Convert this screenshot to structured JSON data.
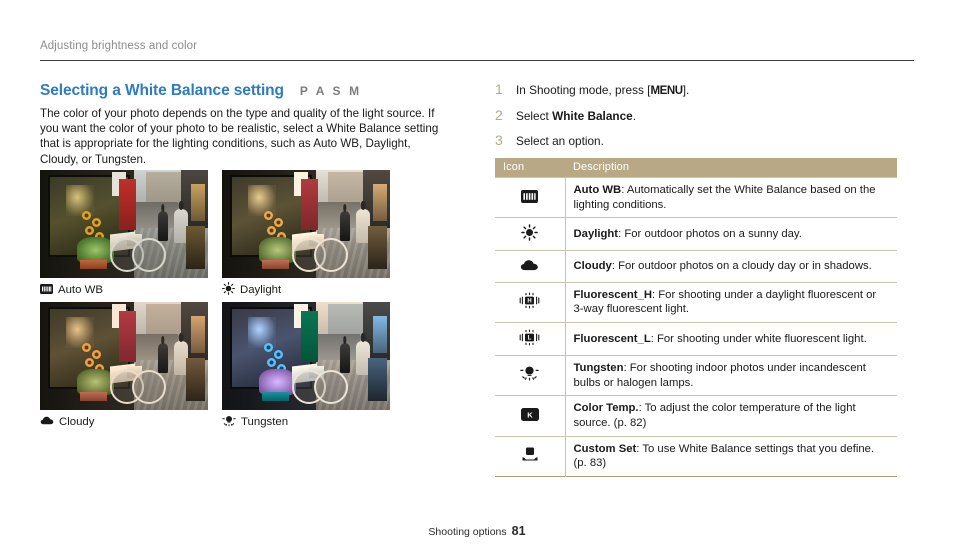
{
  "running_head": "Adjusting brightness and color",
  "section": {
    "title": "Selecting a White Balance setting",
    "modes": "P A S M",
    "body": "The color of your photo depends on the type and quality of the light source. If you want the color of your photo to be realistic, select a White Balance setting that is appropriate for the lighting conditions, such as Auto WB, Daylight, Cloudy, or Tungsten."
  },
  "samples": [
    {
      "caption": "Auto WB",
      "icon": "auto-wb-icon"
    },
    {
      "caption": "Daylight",
      "icon": "daylight-sun-icon"
    },
    {
      "caption": "Cloudy",
      "icon": "cloud-icon"
    },
    {
      "caption": "Tungsten",
      "icon": "tungsten-bulb-icon"
    }
  ],
  "steps": [
    {
      "num": "1",
      "text_before": "In Shooting mode, press [",
      "key": "MENU",
      "text_after": "]."
    },
    {
      "num": "2",
      "text_before": "Select ",
      "bold": "White Balance",
      "text_after": "."
    },
    {
      "num": "3",
      "text_before": "Select an option.",
      "bold": "",
      "text_after": ""
    }
  ],
  "table": {
    "headers": {
      "icon": "Icon",
      "description": "Description"
    },
    "rows": [
      {
        "icon": "auto-wb-icon",
        "term": "Auto WB",
        "description": ": Automatically set the White Balance based on the lighting conditions."
      },
      {
        "icon": "daylight-sun-icon",
        "term": "Daylight",
        "description": ": For outdoor photos on a sunny day."
      },
      {
        "icon": "cloud-icon",
        "term": "Cloudy",
        "description": ": For outdoor photos on a cloudy day or in shadows."
      },
      {
        "icon": "fluorescent-h-icon",
        "term": "Fluorescent_H",
        "description": ": For shooting under a daylight fluorescent or 3-way fluorescent light."
      },
      {
        "icon": "fluorescent-l-icon",
        "term": "Fluorescent_L",
        "description": ": For shooting under white fluorescent light."
      },
      {
        "icon": "tungsten-bulb-icon",
        "term": "Tungsten",
        "description": ": For shooting indoor photos under incandescent bulbs or halogen lamps."
      },
      {
        "icon": "color-temp-k-icon",
        "term": "Color Temp.",
        "description": ": To adjust the color temperature of the light source. (p. 82)"
      },
      {
        "icon": "custom-set-icon",
        "term": "Custom Set",
        "description": ": To use White Balance settings that you define. (p. 83)"
      }
    ]
  },
  "footer": {
    "label": "Shooting options",
    "page": "81"
  },
  "colors": {
    "heading_blue": "#2c7cc0",
    "table_header_tan": "#b9a886",
    "table_border": "#cdc3ad",
    "step_number": "#b9a886",
    "running_head_gray": "#8c8c8c"
  }
}
